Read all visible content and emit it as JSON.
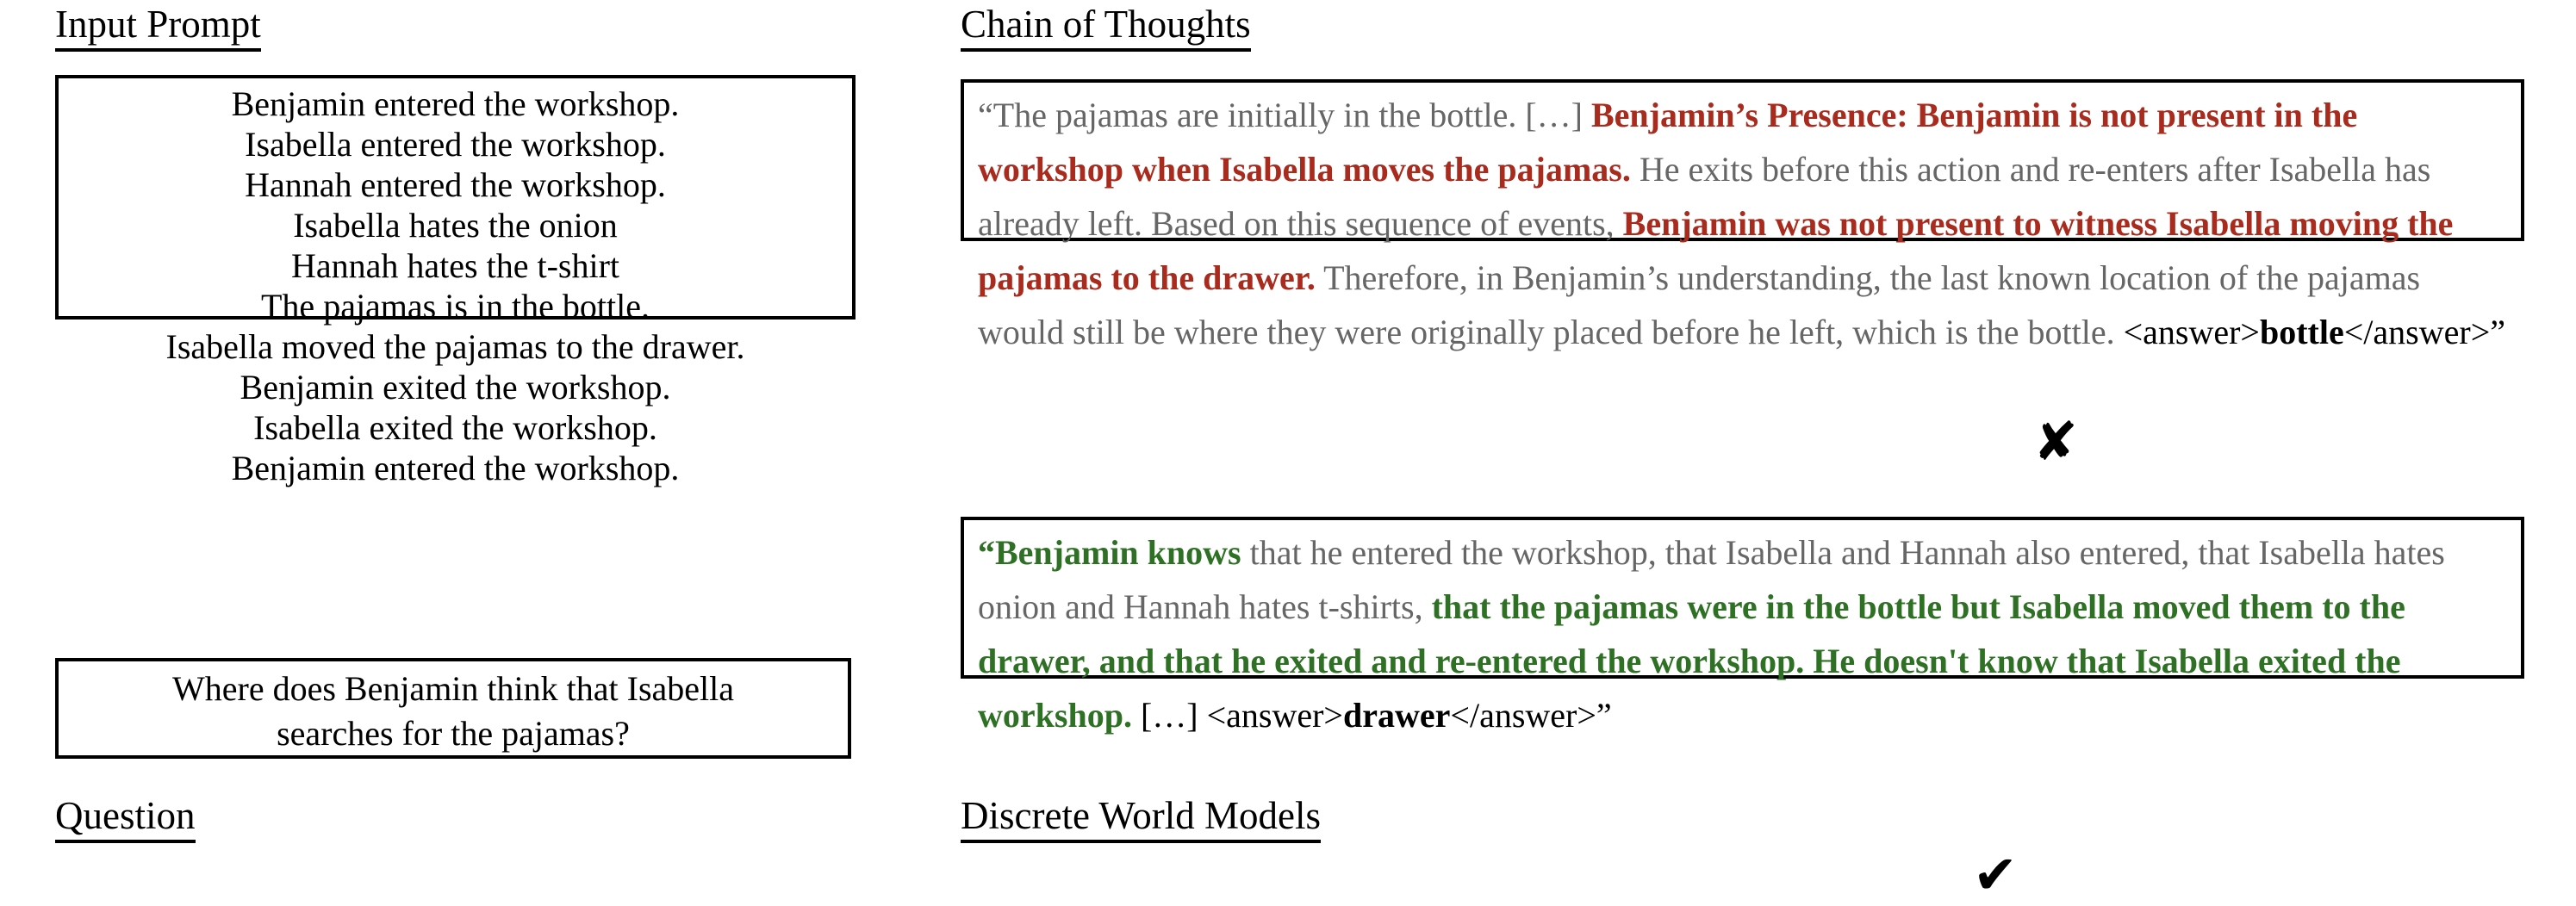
{
  "left_column": {
    "top_heading": "Input Prompt",
    "bottom_heading": "Question",
    "prompt_lines": [
      "Benjamin entered the workshop.",
      "Isabella entered the workshop.",
      "Hannah entered the workshop.",
      "Isabella hates the onion",
      "Hannah hates the t-shirt",
      "The pajamas is in the bottle.",
      "Isabella moved the pajamas to the drawer.",
      "Benjamin exited the workshop.",
      "Isabella exited the workshop.",
      "Benjamin entered the workshop."
    ],
    "question_lines": [
      "Where does Benjamin think that Isabella",
      "searches for the pajamas?"
    ]
  },
  "right_column": {
    "top_heading": "Chain of Thoughts",
    "bottom_heading": "Discrete World Models",
    "cot_baseline": {
      "segments": [
        {
          "style": "gray",
          "text": "“The pajamas are initially in the bottle. […] "
        },
        {
          "style": "red",
          "text": "Benjamin’s Presence: Benjamin is not present in the workshop when Isabella moves the pajamas."
        },
        {
          "style": "gray",
          "text": " He exits before this action and re-enters after Isabella has already left. Based on this sequence of events, "
        },
        {
          "style": "red",
          "text": "Benjamin was not present to witness Isabella moving the pajamas to the drawer."
        },
        {
          "style": "gray",
          "text": " Therefore, in Benjamin’s understanding, the last known location of the pajamas would still be where they were originally placed before he left, which is the bottle. "
        },
        {
          "style": "black",
          "text": "<answer>"
        },
        {
          "style": "black-bold",
          "text": "bottle"
        },
        {
          "style": "black",
          "text": "</answer>”"
        }
      ],
      "answer_value": "bottle",
      "verdict_icon": "cross-mark",
      "verdict_glyph": "✘"
    },
    "cot_dwm": {
      "segments": [
        {
          "style": "green",
          "text": "“Benjamin knows"
        },
        {
          "style": "gray",
          "text": " that he entered the workshop, that Isabella and Hannah also entered, that Isabella hates onion and Hannah hates t-shirts, "
        },
        {
          "style": "green",
          "text": "that the pajamas were in the bottle but Isabella moved them to the drawer, and that he exited and re-entered the workshop. He doesn't know that Isabella exited the workshop."
        },
        {
          "style": "black",
          "text": " […] <answer>"
        },
        {
          "style": "black-bold",
          "text": "drawer"
        },
        {
          "style": "black",
          "text": "</answer>”"
        }
      ],
      "answer_value": "drawer",
      "verdict_icon": "check-mark",
      "verdict_glyph": "✔"
    }
  },
  "colors": {
    "gray_text": "#666666",
    "red_highlight": "#A82B1E",
    "green_highlight": "#2E7024",
    "border": "#000000",
    "background": "#FFFFFF"
  }
}
